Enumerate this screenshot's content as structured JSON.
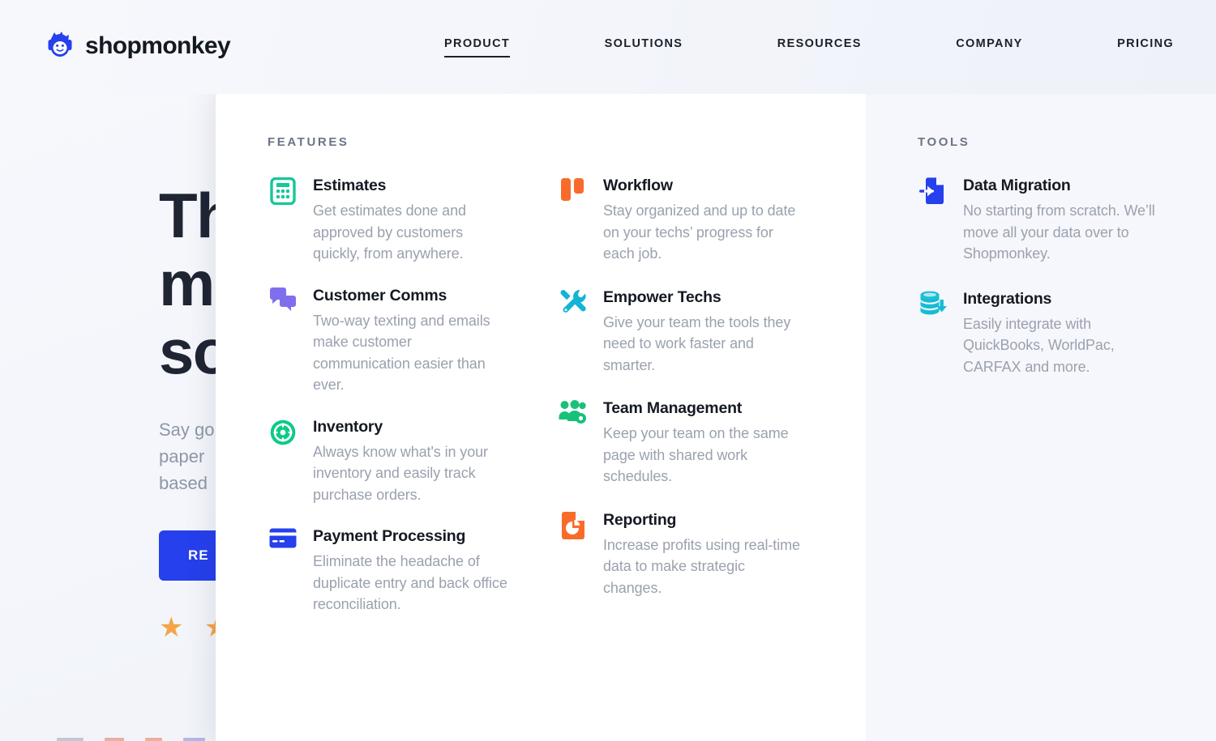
{
  "header": {
    "brand_name": "shopmonkey",
    "brand_icon": "monkey-logo-icon",
    "nav": [
      {
        "label": "PRODUCT",
        "active": true
      },
      {
        "label": "SOLUTIONS",
        "active": false
      },
      {
        "label": "RESOURCES",
        "active": false
      },
      {
        "label": "COMPANY",
        "active": false
      },
      {
        "label": "PRICING",
        "active": false
      }
    ]
  },
  "hero": {
    "title": "Th\nm\nso",
    "subtitle": "Say go\npaper\nbased",
    "cta_label": "RE",
    "stars": "★ ★"
  },
  "dropdown": {
    "features": {
      "label": "FEATURES",
      "column_left": [
        {
          "icon": "calculator-icon",
          "color": "#18c69a",
          "title": "Estimates",
          "desc": "Get estimates done and approved by customers quickly, from anywhere."
        },
        {
          "icon": "chat-bubbles-icon",
          "color": "#7f6fee",
          "title": "Customer Comms",
          "desc": "Two-way texting and emails make customer communication easier than ever."
        },
        {
          "icon": "tire-wheel-icon",
          "color": "#0bcb85",
          "title": "Inventory",
          "desc": "Always know what's in your inventory and easily track purchase orders."
        },
        {
          "icon": "credit-card-icon",
          "color": "#2540ec",
          "title": "Payment Processing",
          "desc": "Eliminate the headache of duplicate entry and back office reconciliation."
        }
      ],
      "column_right": [
        {
          "icon": "kanban-columns-icon",
          "color": "#f96b2b",
          "title": "Workflow",
          "desc": "Stay organized and up to date on your techs’ progress for each job."
        },
        {
          "icon": "wrench-screwdriver-icon",
          "color": "#14b4d4",
          "title": "Empower Techs",
          "desc": "Give your team the tools they need to work faster and smarter."
        },
        {
          "icon": "team-gear-icon",
          "color": "#17c278",
          "title": "Team Management",
          "desc": "Keep your team on the same page with shared work schedules."
        },
        {
          "icon": "report-pie-document-icon",
          "color": "#f96b2b",
          "title": "Reporting",
          "desc": "Increase profits using real-time data to make strategic changes."
        }
      ]
    },
    "tools": {
      "label": "TOOLS",
      "items": [
        {
          "icon": "document-import-arrow-icon",
          "color": "#2540ec",
          "title": "Data Migration",
          "desc": "No starting from scratch. We’ll move all your data over to Shopmonkey."
        },
        {
          "icon": "database-download-icon",
          "color": "#16bcd4",
          "title": "Integrations",
          "desc": "Easily integrate with QuickBooks, WorldPac, CARFAX and more."
        }
      ]
    }
  }
}
